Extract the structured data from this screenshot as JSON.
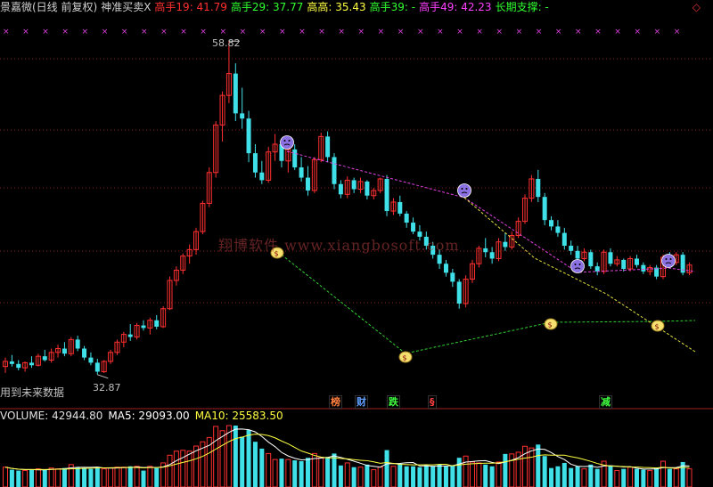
{
  "header": {
    "title": "景嘉微(日线 前复权)",
    "indicator": "神准买卖X",
    "items": [
      {
        "label": "高手19: 41.79",
        "color": "#ff3030"
      },
      {
        "label": "高手29: 37.77",
        "color": "#30ff30"
      },
      {
        "label": "高高: 35.43",
        "color": "#ffff40"
      },
      {
        "label": "高手39: -",
        "color": "#30ff30"
      },
      {
        "label": "高手49: 42.23",
        "color": "#ff40ff"
      },
      {
        "label": "长期支撑: -",
        "color": "#30ff30"
      }
    ]
  },
  "price_labels": {
    "high": "58.82",
    "low": "32.87"
  },
  "future_data_label": "用到未来数据",
  "watermark": "翔博软件 www.xiangbosoft.com",
  "event_markers": [
    {
      "text": "榜",
      "color": "#ff8040"
    },
    {
      "text": "财",
      "color": "#60a0ff"
    },
    {
      "text": "跌",
      "color": "#40ff40"
    },
    {
      "text": "§",
      "color": "#ff4040"
    },
    {
      "text": "减",
      "color": "#40ff40"
    }
  ],
  "volume_header": {
    "volume": "VOLUME: 42944.80",
    "ma5": "MA5: 29093.00",
    "ma10": "MA10: 25583.50",
    "ma5_color": "#ffffff",
    "ma10_color": "#ffff40"
  },
  "chart_data": {
    "type": "candlestick",
    "colors": {
      "up": "#ff3030",
      "down": "#40e0e8"
    },
    "price_range": [
      32.87,
      58.82
    ],
    "candles": [
      [
        33.5,
        34.2,
        33.0,
        33.9
      ],
      [
        33.9,
        34.4,
        33.5,
        33.7
      ],
      [
        33.7,
        34.0,
        33.2,
        33.4
      ],
      [
        33.4,
        33.9,
        33.1,
        33.8
      ],
      [
        33.8,
        34.3,
        33.4,
        33.6
      ],
      [
        33.6,
        34.5,
        33.5,
        34.3
      ],
      [
        34.3,
        34.8,
        33.9,
        34.0
      ],
      [
        34.0,
        34.9,
        33.8,
        34.6
      ],
      [
        34.6,
        35.2,
        34.2,
        34.9
      ],
      [
        34.9,
        35.4,
        34.3,
        34.5
      ],
      [
        34.5,
        35.8,
        34.3,
        35.6
      ],
      [
        35.6,
        35.9,
        34.7,
        34.9
      ],
      [
        34.9,
        35.1,
        34.0,
        34.2
      ],
      [
        34.2,
        34.6,
        33.6,
        33.8
      ],
      [
        33.8,
        34.1,
        32.87,
        33.1
      ],
      [
        33.1,
        34.0,
        33.0,
        33.9
      ],
      [
        33.9,
        34.8,
        33.7,
        34.6
      ],
      [
        34.6,
        35.6,
        34.4,
        35.4
      ],
      [
        35.4,
        36.2,
        35.0,
        36.0
      ],
      [
        36.0,
        36.8,
        35.5,
        35.8
      ],
      [
        35.8,
        36.9,
        35.6,
        36.7
      ],
      [
        36.7,
        37.1,
        36.3,
        36.5
      ],
      [
        36.5,
        37.3,
        36.0,
        37.1
      ],
      [
        37.1,
        37.5,
        36.4,
        36.6
      ],
      [
        36.6,
        38.2,
        36.5,
        38.0
      ],
      [
        38.0,
        40.5,
        37.9,
        40.2
      ],
      [
        40.2,
        41.3,
        39.8,
        41.0
      ],
      [
        41.0,
        42.3,
        40.7,
        42.1
      ],
      [
        42.1,
        43.0,
        41.5,
        42.6
      ],
      [
        42.6,
        44.3,
        42.2,
        44.0
      ],
      [
        44.0,
        46.4,
        43.8,
        46.2
      ],
      [
        46.2,
        49.0,
        45.9,
        48.6
      ],
      [
        48.6,
        52.6,
        48.2,
        52.3
      ],
      [
        52.3,
        54.9,
        51.0,
        54.6
      ],
      [
        54.6,
        58.82,
        54.0,
        56.3
      ],
      [
        56.3,
        57.1,
        52.6,
        53.2
      ],
      [
        53.2,
        55.2,
        52.0,
        52.8
      ],
      [
        52.8,
        53.4,
        49.4,
        50.1
      ],
      [
        50.1,
        50.8,
        48.2,
        48.6
      ],
      [
        48.6,
        49.5,
        47.7,
        48.0
      ],
      [
        48.0,
        50.6,
        47.8,
        50.2
      ],
      [
        50.2,
        51.6,
        49.5,
        50.8
      ],
      [
        50.8,
        51.2,
        49.0,
        49.5
      ],
      [
        49.5,
        50.7,
        48.6,
        50.4
      ],
      [
        50.4,
        50.8,
        48.8,
        49.0
      ],
      [
        49.0,
        49.8,
        47.9,
        48.2
      ],
      [
        48.2,
        49.1,
        46.8,
        47.2
      ],
      [
        47.2,
        49.8,
        47.0,
        49.6
      ],
      [
        49.6,
        51.7,
        49.4,
        51.4
      ],
      [
        51.4,
        51.8,
        49.4,
        49.8
      ],
      [
        49.8,
        50.1,
        47.3,
        47.7
      ],
      [
        47.7,
        48.0,
        46.6,
        46.9
      ],
      [
        46.9,
        48.3,
        46.6,
        48.0
      ],
      [
        48.0,
        48.2,
        47.0,
        47.3
      ],
      [
        47.3,
        48.2,
        47.0,
        47.9
      ],
      [
        47.9,
        48.0,
        46.5,
        46.8
      ],
      [
        46.8,
        47.4,
        46.5,
        47.2
      ],
      [
        47.2,
        48.2,
        47.0,
        48.1
      ],
      [
        48.1,
        48.4,
        45.2,
        45.6
      ],
      [
        45.6,
        46.6,
        45.3,
        46.3
      ],
      [
        46.3,
        46.8,
        45.2,
        45.4
      ],
      [
        45.4,
        45.6,
        44.3,
        44.7
      ],
      [
        44.7,
        45.1,
        43.8,
        44.0
      ],
      [
        44.0,
        44.5,
        43.3,
        43.6
      ],
      [
        43.6,
        44.0,
        42.6,
        42.9
      ],
      [
        42.9,
        43.2,
        41.9,
        42.2
      ],
      [
        42.2,
        42.6,
        41.1,
        41.5
      ],
      [
        41.5,
        41.8,
        40.5,
        40.8
      ],
      [
        40.8,
        41.1,
        39.7,
        40.1
      ],
      [
        40.1,
        40.3,
        38.0,
        38.4
      ],
      [
        38.4,
        40.6,
        38.1,
        40.3
      ],
      [
        40.3,
        41.8,
        40.0,
        41.5
      ],
      [
        41.5,
        42.9,
        41.2,
        42.7
      ],
      [
        42.7,
        43.5,
        42.0,
        42.4
      ],
      [
        42.4,
        42.8,
        41.5,
        41.9
      ],
      [
        41.9,
        43.5,
        41.7,
        43.2
      ],
      [
        43.2,
        43.9,
        42.5,
        42.8
      ],
      [
        42.8,
        44.0,
        42.6,
        43.7
      ],
      [
        43.7,
        45.1,
        43.5,
        44.8
      ],
      [
        44.8,
        46.9,
        44.6,
        46.6
      ],
      [
        46.6,
        48.4,
        46.3,
        48.1
      ],
      [
        48.1,
        48.8,
        46.3,
        46.7
      ],
      [
        46.7,
        47.0,
        44.5,
        44.9
      ],
      [
        44.9,
        45.2,
        44.1,
        44.4
      ],
      [
        44.4,
        44.9,
        43.6,
        43.9
      ],
      [
        43.9,
        44.3,
        42.6,
        42.9
      ],
      [
        42.9,
        43.3,
        42.2,
        42.5
      ],
      [
        42.5,
        42.9,
        41.6,
        41.9
      ],
      [
        41.9,
        42.7,
        41.7,
        42.4
      ],
      [
        42.4,
        42.6,
        41.1,
        41.3
      ],
      [
        41.3,
        41.6,
        40.6,
        40.9
      ],
      [
        40.9,
        42.6,
        40.7,
        42.4
      ],
      [
        42.4,
        42.7,
        41.3,
        41.5
      ],
      [
        41.5,
        42.1,
        41.3,
        41.8
      ],
      [
        41.8,
        41.9,
        40.9,
        41.1
      ],
      [
        41.1,
        42.1,
        40.9,
        41.9
      ],
      [
        41.9,
        42.2,
        41.2,
        41.4
      ],
      [
        41.4,
        41.6,
        40.7,
        40.9
      ],
      [
        40.9,
        41.4,
        40.6,
        41.2
      ],
      [
        41.2,
        41.4,
        40.3,
        40.5
      ],
      [
        40.5,
        42.2,
        40.3,
        42.0
      ],
      [
        42.0,
        42.4,
        41.4,
        41.6
      ],
      [
        41.6,
        42.4,
        41.4,
        42.2
      ],
      [
        42.2,
        42.4,
        40.6,
        40.8
      ],
      [
        40.8,
        41.6,
        40.6,
        41.4
      ]
    ],
    "volume_ma5": 29093.0,
    "volume_ma10": 25583.5,
    "last_volume": 42944.8
  }
}
